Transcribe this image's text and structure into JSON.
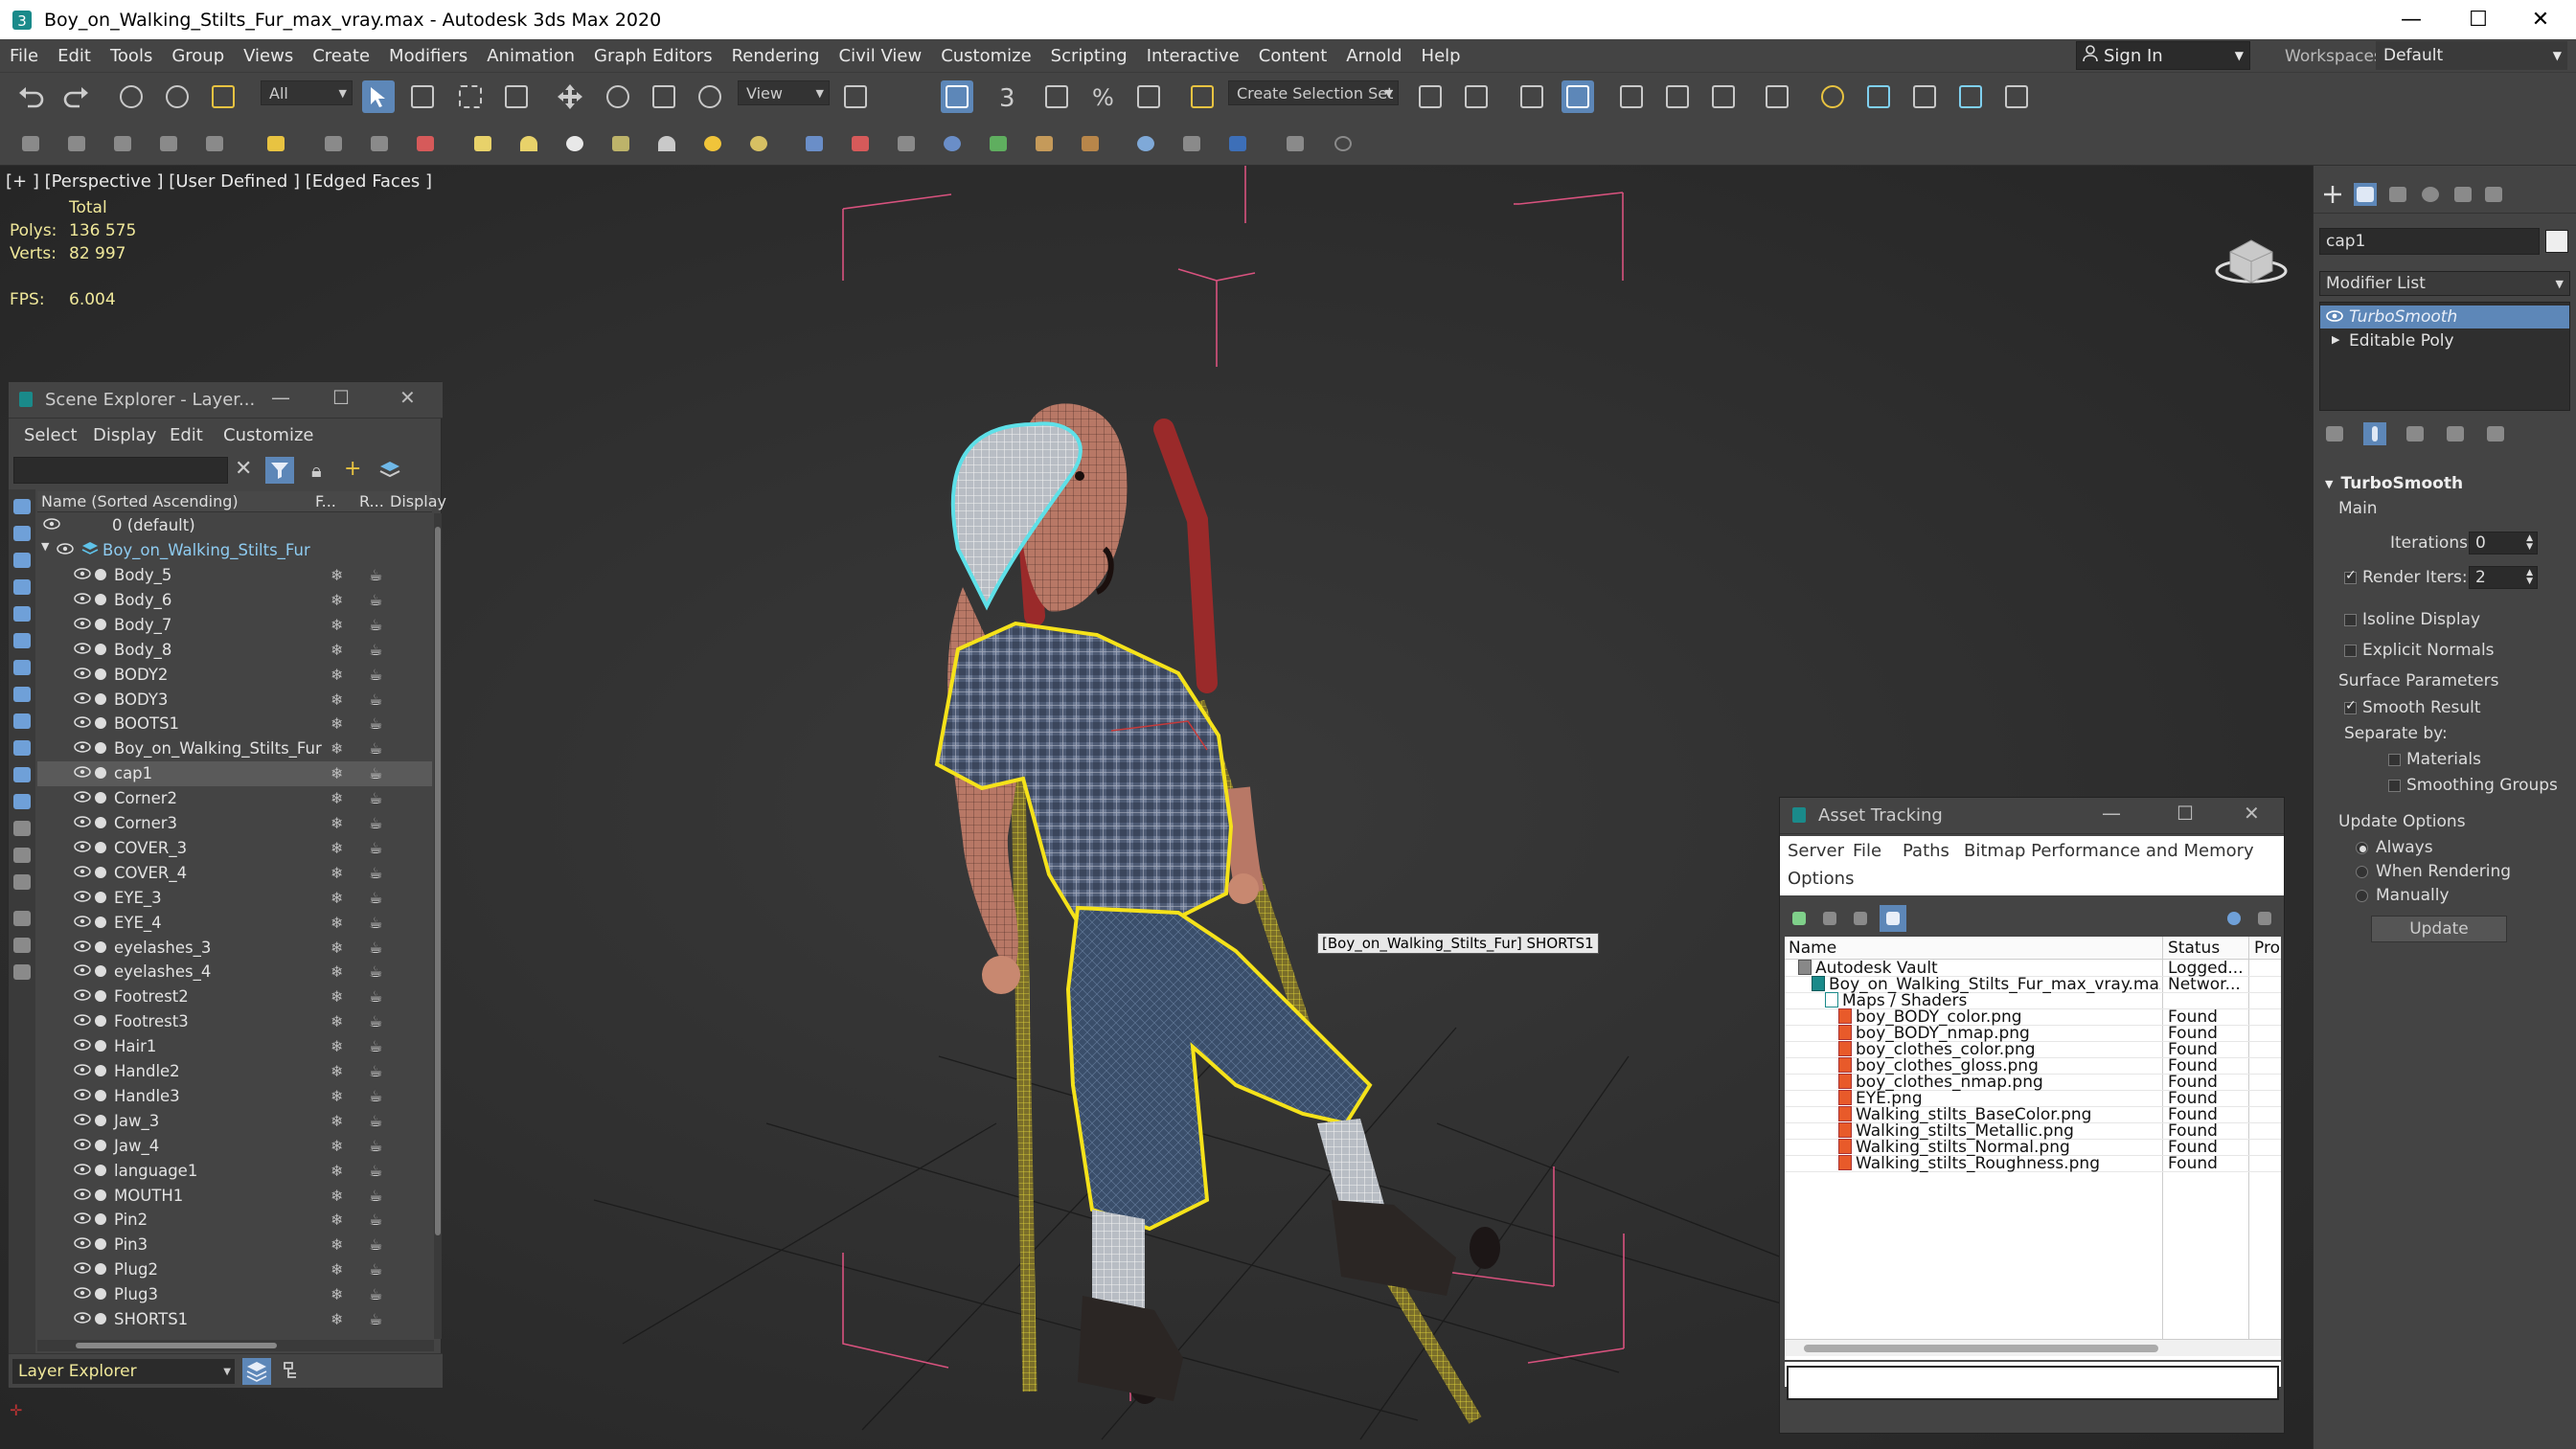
{
  "window": {
    "title": "Boy_on_Walking_Stilts_Fur_max_vray.max - Autodesk 3ds Max 2020",
    "minimize": "—",
    "maximize": "☐",
    "close": "✕"
  },
  "menu": [
    "File",
    "Edit",
    "Tools",
    "Group",
    "Views",
    "Create",
    "Modifiers",
    "Animation",
    "Graph Editors",
    "Rendering",
    "Civil View",
    "Customize",
    "Scripting",
    "Interactive",
    "Content",
    "Arnold",
    "Help"
  ],
  "signin": {
    "label": "Sign In",
    "arrow": "▼"
  },
  "workspace": {
    "label": "Workspaces:",
    "value": "Default"
  },
  "toolbar": {
    "filter_value": "All",
    "refcoord_value": "View",
    "selection_set": "Create Selection Set",
    "angle_snap": "3"
  },
  "viewport": {
    "label": "[+ ] [Perspective ] [User Defined ] [Edged Faces ]",
    "stats": {
      "total_label": "Total",
      "polys_label": "Polys:",
      "polys_value": "136 575",
      "verts_label": "Verts:",
      "verts_value": "82 997",
      "fps_label": "FPS:",
      "fps_value": "6.004"
    },
    "tooltip": "[Boy_on_Walking_Stilts_Fur] SHORTS1"
  },
  "scene_explorer": {
    "title": "Scene Explorer - Layer...",
    "menu": [
      "Select",
      "Display",
      "Edit",
      "Customize"
    ],
    "columns": {
      "name": "Name (Sorted Ascending)",
      "f": "F...",
      "r": "R...",
      "display": "Display"
    },
    "layer_default": "0 (default)",
    "layer_main": "Boy_on_Walking_Stilts_Fur",
    "items": [
      "Body_5",
      "Body_6",
      "Body_7",
      "Body_8",
      "BODY2",
      "BODY3",
      "BOOTS1",
      "Boy_on_Walking_Stilts_Fur",
      "cap1",
      "Corner2",
      "Corner3",
      "COVER_3",
      "COVER_4",
      "EYE_3",
      "EYE_4",
      "eyelashes_3",
      "eyelashes_4",
      "Footrest2",
      "Footrest3",
      "Hair1",
      "Handle2",
      "Handle3",
      "Jaw_3",
      "Jaw_4",
      "language1",
      "MOUTH1",
      "Pin2",
      "Pin3",
      "Plug2",
      "Plug3",
      "SHORTS1"
    ],
    "selected": "cap1",
    "footer": "Layer Explorer"
  },
  "command_panel": {
    "object_name": "cap1",
    "modifier_list": "Modifier List",
    "stack": [
      "TurboSmooth",
      "Editable Poly"
    ],
    "rollout_title": "TurboSmooth",
    "main_label": "Main",
    "iterations_label": "Iterations:",
    "iterations_value": "0",
    "render_iters_label": "Render Iters:",
    "render_iters_value": "2",
    "isoline": "Isoline Display",
    "explicit_normals": "Explicit Normals",
    "surface_params": "Surface Parameters",
    "smooth_result": "Smooth Result",
    "separate_by": "Separate by:",
    "materials": "Materials",
    "smoothing_groups": "Smoothing Groups",
    "update_options": "Update Options",
    "always": "Always",
    "when_rendering": "When Rendering",
    "manually": "Manually",
    "update_button": "Update"
  },
  "asset_tracking": {
    "title": "Asset Tracking",
    "menu": [
      "Server",
      "File",
      "Paths",
      "Bitmap Performance and Memory",
      "Options"
    ],
    "columns": {
      "name": "Name",
      "status": "Status",
      "pro": "Pro"
    },
    "rows": [
      {
        "name": "Autodesk Vault",
        "status": "Logged..."
      },
      {
        "name": "Boy_on_Walking_Stilts_Fur_max_vray.max",
        "status": "Networ..."
      },
      {
        "name": "Maps / Shaders",
        "status": ""
      },
      {
        "name": "boy_BODY_color.png",
        "status": "Found"
      },
      {
        "name": "boy_BODY_nmap.png",
        "status": "Found"
      },
      {
        "name": "boy_clothes_color.png",
        "status": "Found"
      },
      {
        "name": "boy_clothes_gloss.png",
        "status": "Found"
      },
      {
        "name": "boy_clothes_nmap.png",
        "status": "Found"
      },
      {
        "name": "EYE.png",
        "status": "Found"
      },
      {
        "name": "Walking_stilts_BaseColor.png",
        "status": "Found"
      },
      {
        "name": "Walking_stilts_Metallic.png",
        "status": "Found"
      },
      {
        "name": "Walking_stilts_Normal.png",
        "status": "Found"
      },
      {
        "name": "Walking_stilts_Roughness.png",
        "status": "Found"
      }
    ]
  },
  "colors": {
    "ui_bg": "#444444",
    "viewport_bg": "#2d2d2d",
    "accent": "#5d87b8",
    "selection_yellow": "#f5e21a",
    "selection_cyan": "#5ee0e8",
    "stat_text": "#f0e89a",
    "box_pink": "#d8527e"
  }
}
